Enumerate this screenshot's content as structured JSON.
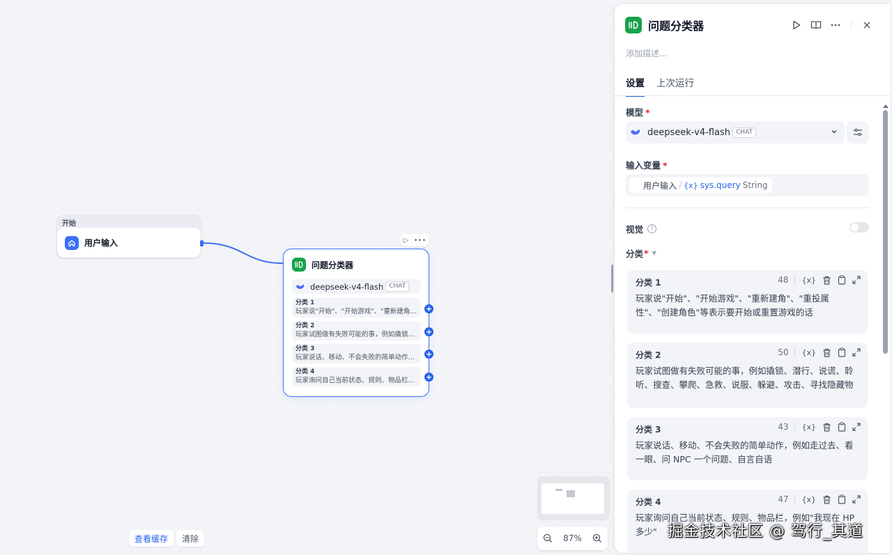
{
  "canvas": {
    "start_group_label": "开始",
    "start_node_title": "用户输入",
    "classifier_node": {
      "title": "问题分类器",
      "model_name": "deepseek-v4-flash",
      "model_tag": "CHAT",
      "classes": [
        {
          "name": "分类 1",
          "desc": "玩家说\"开始\"、\"开始游戏\"、\"重新建角\"、\"重投属性\"、\"创建角色\"等表示要开始或重置游戏的话"
        },
        {
          "name": "分类 2",
          "desc": "玩家试图做有失败可能的事，例如撬锁、潜行、说谎、聆听、搜查、攀爬、急救、说服、躲避、攻击、寻找隐藏物"
        },
        {
          "name": "分类 3",
          "desc": "玩家说话、移动、不会失败的简单动作，例如走过去、看一眼、问 NPC 一个问题、自言自语"
        },
        {
          "name": "分类 4",
          "desc": "玩家询问自己当前状态、规则、物品栏，例如\"我现在 HP 多少\""
        }
      ]
    },
    "bottom_buttons": {
      "view_cache": "查看缓存",
      "clear": "清除"
    },
    "zoom_level": "87%"
  },
  "panel": {
    "title": "问题分类器",
    "description_placeholder": "添加描述...",
    "tabs": [
      "设置",
      "上次运行"
    ],
    "model": {
      "label": "模型",
      "required_mark": "*",
      "name": "deepseek-v4-flash",
      "tag": "CHAT"
    },
    "input_var": {
      "label": "输入变量",
      "required_mark": "*",
      "source": "用户输入",
      "separator": "/",
      "var_icon": "{x}",
      "var_name": "sys.query",
      "var_type": "String"
    },
    "vision": {
      "label": "视觉",
      "help_icon": "?"
    },
    "classes_label": "分类",
    "classes_required_mark": "*",
    "classes": [
      {
        "name": "分类 1",
        "count": "48",
        "desc": "玩家说\"开始\"、\"开始游戏\"、\"重新建角\"、\"重投属性\"、\"创建角色\"等表示要开始或重置游戏的话"
      },
      {
        "name": "分类 2",
        "count": "50",
        "desc": "玩家试图做有失败可能的事，例如撬锁、潜行、说谎、聆听、搜查、攀爬、急救、说服、躲避、攻击、寻找隐藏物"
      },
      {
        "name": "分类 3",
        "count": "43",
        "desc": "玩家说话、移动、不会失败的简单动作，例如走过去、看一眼、问 NPC 一个问题、自言自语"
      },
      {
        "name": "分类 4",
        "count": "47",
        "desc": "玩家询问自己当前状态、规则、物品栏，例如\"我现在 HP 多少\""
      }
    ],
    "var_icon_label": "{x}"
  },
  "watermark": "掘金技术社区 @ 驾行_其道",
  "colors": {
    "accent": "#3b6ff5",
    "node_green": "#16a34a",
    "required": "#dc2626"
  }
}
